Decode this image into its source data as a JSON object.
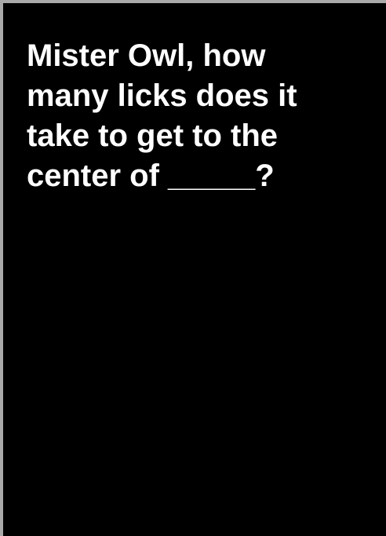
{
  "card": {
    "prompt_text": "Mister Owl, how\nmany licks does it\ntake to get to the\ncenter of _____?",
    "background_color": "#000000",
    "text_color": "#ffffff",
    "frame_color": "#a9a9a9"
  }
}
